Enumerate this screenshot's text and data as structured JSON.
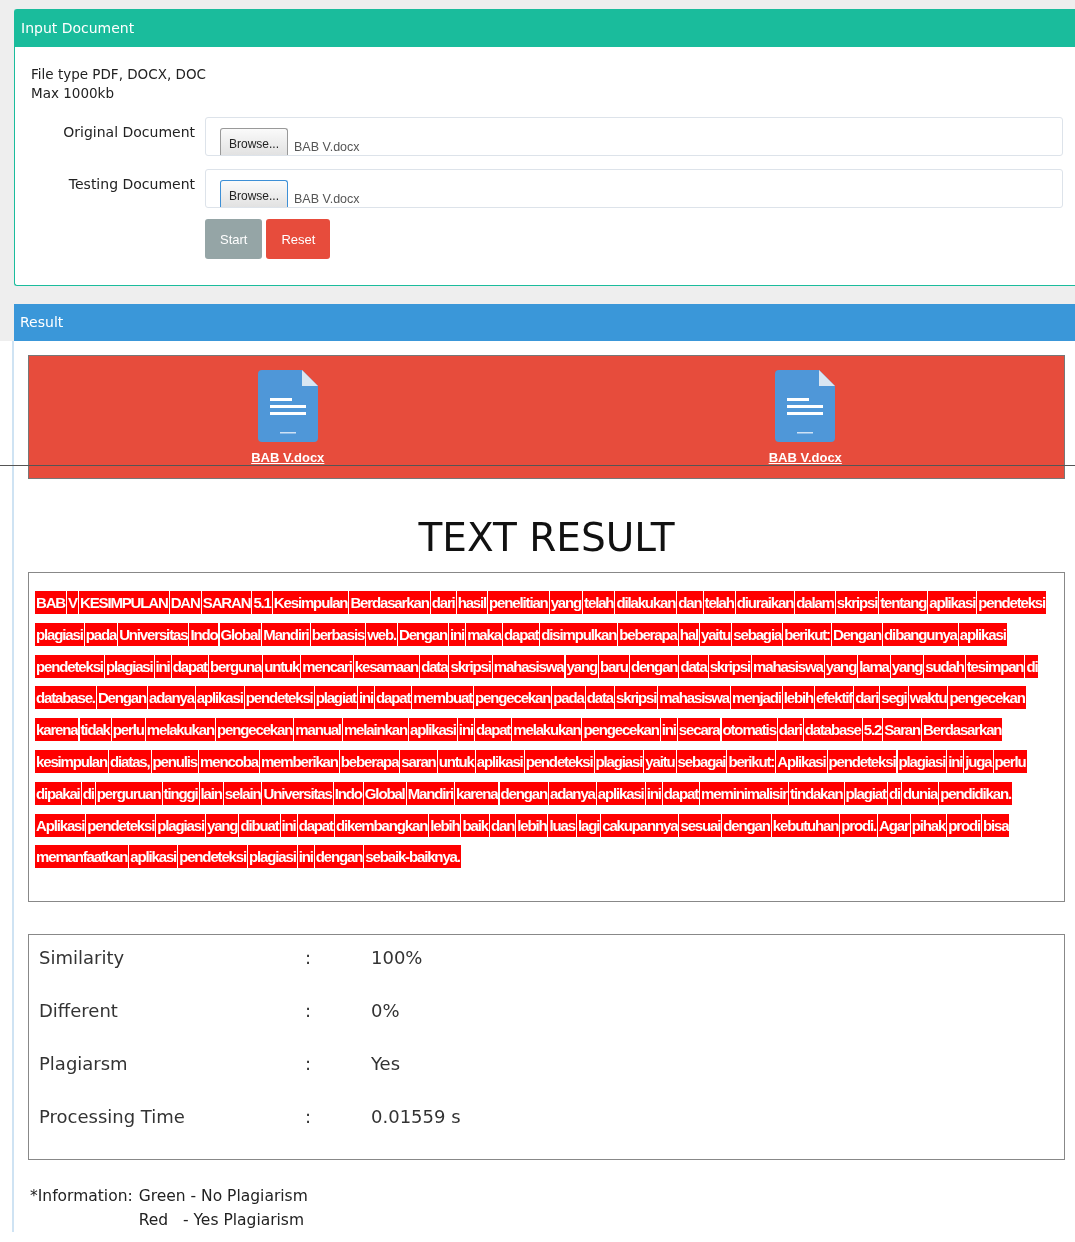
{
  "input_panel": {
    "title": "Input Document",
    "notes": [
      "File type PDF, DOCX, DOC",
      "Max 1000kb"
    ],
    "fields": [
      {
        "label": "Original Document",
        "button": "Browse...",
        "value": "BAB V.docx",
        "focused": false
      },
      {
        "label": "Testing Document",
        "button": "Browse...",
        "value": "BAB V.docx",
        "focused": true
      }
    ],
    "buttons": [
      {
        "label": "Start",
        "kind": "neutral"
      },
      {
        "label": "Reset",
        "kind": "danger"
      }
    ]
  },
  "result_panel": {
    "title": "Result",
    "plagiarism": true,
    "documents": [
      {
        "name": "BAB V.docx"
      },
      {
        "name": "BAB V.docx"
      }
    ],
    "heading": "TEXT RESULT",
    "text": "BAB V KESIMPULAN DAN SARAN 5.1 Kesimpulan Berdasarkan dari hasil penelitian yang telah dilakukan dan telah diuraikan dalam skripsi tentang aplikasi pendeteksi plagiasi pada Universitas Indo Global Mandiri berbasis web. Dengan ini maka dapat disimpulkan beberapa hal yaitu sebagia berikut: Dengan dibangunya aplikasi pendeteksi plagiasi ini dapat berguna untuk mencari kesamaan data skripsi mahasiswa yang baru dengan data skripsi mahasiswa yang lama yang sudah tesimpan di database. Dengan adanya aplikasi pendeteksi plagiat ini dapat membuat pengecekan pada data skripsi mahasiswa menjadi lebih efektif dari segi waktu pengecekan karena tidak perlu melakukan pengecekan manual melainkan aplikasi ini dapat melakukan pengecekan ini secara otomatis dari database 5.2 Saran Berdasarkan kesimpulan diatas, penulis mencoba memberikan beberapa saran untuk aplikasi pendeteksi plagiasi yaitu sebagai berikut: Aplikasi pendeteksi plagiasi ini juga perlu dipakai di perguruan tinggi lain selain Universitas Indo Global Mandiri karena dengan adanya aplikasi ini dapat meminimalisir tindakan plagiat di dunia pendidikan. Aplikasi pendeteksi plagiasi yang dibuat ini dapat dikembangkan lebih baik dan lebih luas lagi cakupannya sesuai dengan kebutuhan prodi. Agar pihak prodi bisa memanfaatkan aplikasi pendeteksi plagiasi ini dengan sebaik-baiknya.",
    "stats": [
      {
        "label": "Similarity",
        "separator": ":",
        "value": "100%"
      },
      {
        "label": "Different",
        "separator": ":",
        "value": "0%"
      },
      {
        "label": "Plagiarsm",
        "separator": ":",
        "value": "Yes"
      },
      {
        "label": "Processing Time",
        "separator": ":",
        "value": "0.01559 s"
      }
    ],
    "info_label": "*Information:",
    "info_lines": [
      "Green - No Plagiarism",
      "Red   - Yes Plagiarism"
    ]
  }
}
